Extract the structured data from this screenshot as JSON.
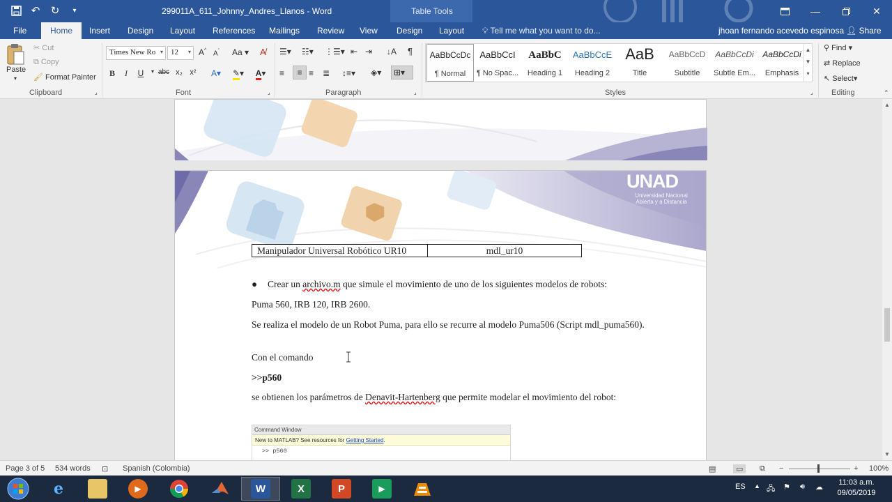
{
  "window": {
    "doc_title": "299011A_611_Johnny_Andres_Llanos  -  Word",
    "table_tools": "Table Tools",
    "quick_access_icons": [
      "save-icon",
      "undo-icon",
      "redo-icon",
      "customize-icon"
    ]
  },
  "tabs": [
    "File",
    "Home",
    "Insert",
    "Design",
    "Layout",
    "References",
    "Mailings",
    "Review",
    "View",
    "Design",
    "Layout"
  ],
  "active_tab": "Home",
  "tellme": "Tell me what you want to do...",
  "user": "jhoan fernando acevedo espinosa",
  "share": "Share",
  "clipboard": {
    "paste": "Paste",
    "cut": "Cut",
    "copy": "Copy",
    "format_painter": "Format Painter",
    "label": "Clipboard"
  },
  "font": {
    "name": "Times New Ro",
    "size": "12",
    "label": "Font",
    "buttons": [
      "B",
      "I",
      "U",
      "abc",
      "x₂",
      "x²"
    ]
  },
  "paragraph": {
    "label": "Paragraph"
  },
  "styles": {
    "label": "Styles",
    "items": [
      {
        "preview": "AaBbCcDc",
        "name": "¶ Normal"
      },
      {
        "preview": "AaBbCcI",
        "name": "¶ No Spac..."
      },
      {
        "preview": "AaBbC",
        "name": "Heading 1"
      },
      {
        "preview": "AaBbCcE",
        "name": "Heading 2"
      },
      {
        "preview": "AaB",
        "name": "Title"
      },
      {
        "preview": "AaBbCcD",
        "name": "Subtitle"
      },
      {
        "preview": "AaBbCcDi",
        "name": "Subtle Em..."
      },
      {
        "preview": "AaBbCcDi",
        "name": "Emphasis"
      }
    ]
  },
  "editing": {
    "find": "Find",
    "replace": "Replace",
    "select": "Select",
    "label": "Editing"
  },
  "document": {
    "logo": {
      "main": "UNAD",
      "sub1": "Universidad Nacional",
      "sub2": "Abierta y a Distancia"
    },
    "table": {
      "cell1": "Manipulador Universal Robótico UR10",
      "cell2": "mdl_ur10"
    },
    "bullet_pre": "Crear un ",
    "bullet_link": "archivo.m",
    "bullet_post": " que simule el movimiento de uno de los siguientes modelos de robots:",
    "p1": "Puma 560, IRB 120, IRB 2600.",
    "p2": "Se realiza el modelo de un Robot Puma, para ello se recurre al modelo Puma506 (Script mdl_puma560).",
    "p3": "Con el comando",
    "p4": ">>p560",
    "p5_pre": "se obtienen los parámetros de ",
    "p5_link": "Denavit-Hartenberg",
    "p5_post": " que permite modelar el movimiento del robot:",
    "matlab": {
      "title": "Command Window",
      "tip_pre": "New to MATLAB? See resources for ",
      "tip_link": "Getting Started",
      "tip_post": ".",
      "cmd": ">> p560"
    }
  },
  "status": {
    "page": "Page 3 of 5",
    "words": "534 words",
    "language": "Spanish (Colombia)",
    "zoom": "100%"
  },
  "taskbar": {
    "apps": [
      "start",
      "internet-explorer",
      "file-explorer",
      "media-player",
      "chrome",
      "matlab",
      "word",
      "excel",
      "powerpoint",
      "camtasia",
      "vlc"
    ],
    "active_app": "word",
    "lang": "ES",
    "time": "11:03 a.m.",
    "date": "09/05/2019"
  }
}
